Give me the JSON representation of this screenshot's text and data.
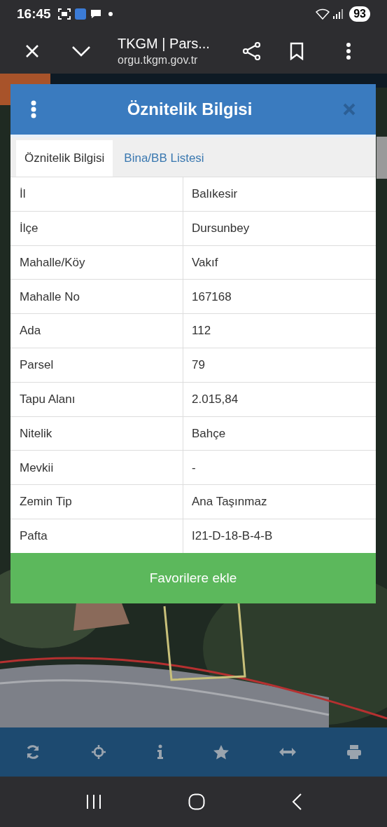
{
  "status_bar": {
    "time": "16:45",
    "battery": "93"
  },
  "browser": {
    "title": "TKGM | Pars...",
    "url": "orgu.tkgm.gov.tr"
  },
  "dialog": {
    "title": "Öznitelik Bilgisi",
    "tabs": [
      {
        "label": "Öznitelik Bilgisi",
        "selected": true
      },
      {
        "label": "Bina/BB Listesi",
        "selected": false
      }
    ],
    "rows": [
      {
        "label": "İl",
        "value": "Balıkesir"
      },
      {
        "label": "İlçe",
        "value": "Dursunbey"
      },
      {
        "label": "Mahalle/Köy",
        "value": "Vakıf"
      },
      {
        "label": "Mahalle No",
        "value": "167168"
      },
      {
        "label": "Ada",
        "value": "112"
      },
      {
        "label": "Parsel",
        "value": "79"
      },
      {
        "label": "Tapu Alanı",
        "value": "2.015,84"
      },
      {
        "label": "Nitelik",
        "value": "Bahçe"
      },
      {
        "label": "Mevkii",
        "value": "-"
      },
      {
        "label": "Zemin Tip",
        "value": "Ana Taşınmaz"
      },
      {
        "label": "Pafta",
        "value": "I21-D-18-B-4-B"
      }
    ],
    "button": "Favorilere ekle"
  }
}
